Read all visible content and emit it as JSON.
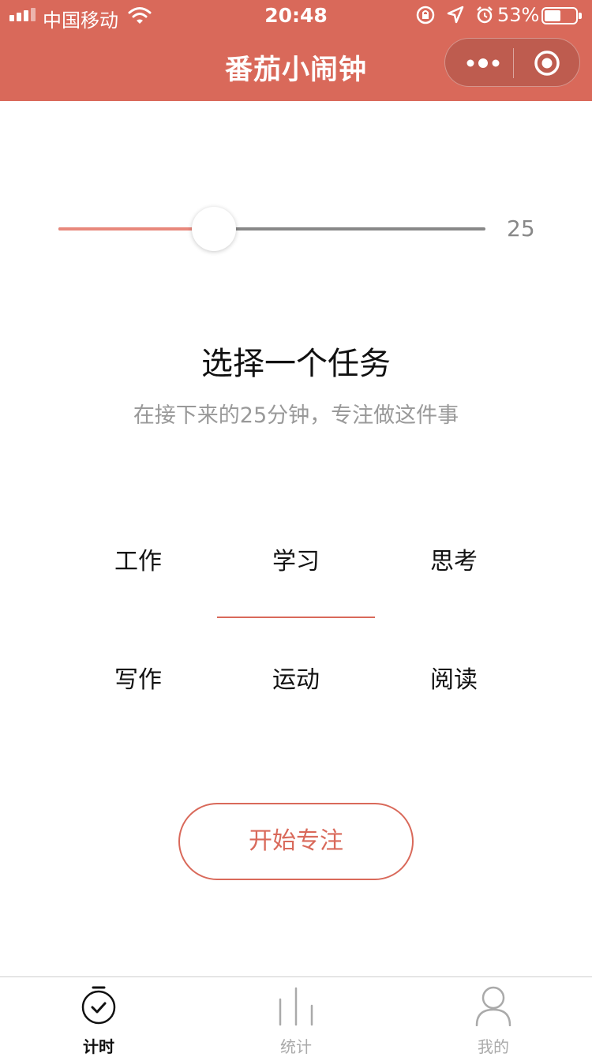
{
  "status_bar": {
    "carrier": "中国移动",
    "time": "20:48",
    "battery_percent": "53%",
    "battery_level": 0.53,
    "icons": [
      "signal-icon",
      "wifi-icon",
      "rotation-lock-icon",
      "location-icon",
      "alarm-icon",
      "battery-icon"
    ]
  },
  "nav": {
    "title": "番茄小闹钟",
    "capsule_icons": [
      "more-dots-icon",
      "close-target-icon"
    ]
  },
  "slider": {
    "value": 25,
    "value_text": "25",
    "min": 5,
    "max": 60,
    "fill_color": "#E8887C",
    "track_color": "#888888"
  },
  "task_section": {
    "title": "选择一个任务",
    "subtitle": "在接下来的25分钟，专注做这件事"
  },
  "tasks": [
    {
      "label": "工作",
      "selected": false
    },
    {
      "label": "学习",
      "selected": true
    },
    {
      "label": "思考",
      "selected": false
    },
    {
      "label": "写作",
      "selected": false
    },
    {
      "label": "运动",
      "selected": false
    },
    {
      "label": "阅读",
      "selected": false
    }
  ],
  "start_button": {
    "label": "开始专注"
  },
  "tabbar": {
    "items": [
      {
        "label": "计时",
        "icon": "timer-check-icon",
        "active": true
      },
      {
        "label": "统计",
        "icon": "stats-bars-icon",
        "active": false
      },
      {
        "label": "我的",
        "icon": "user-icon",
        "active": false
      }
    ]
  },
  "colors": {
    "accent": "#D9695A",
    "header_bg": "#D9695A",
    "muted_text": "#999999",
    "inactive_tab": "#aaaaaa"
  }
}
